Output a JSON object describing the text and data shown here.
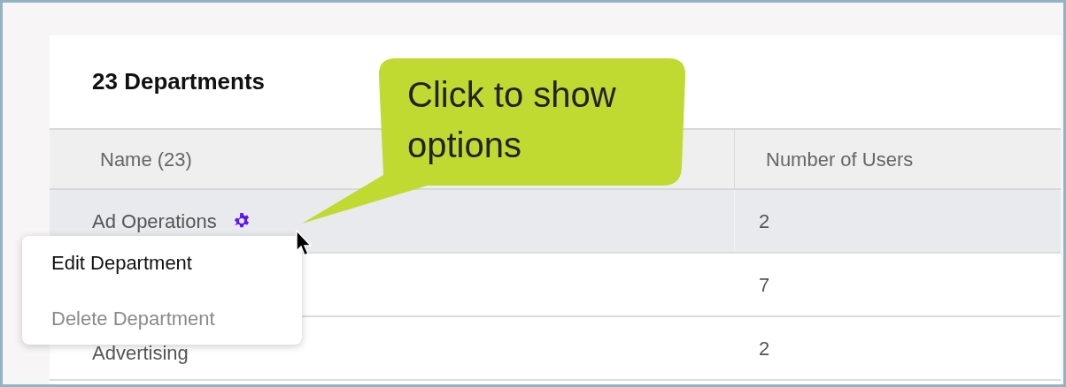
{
  "title": "23 Departments",
  "table": {
    "columns": [
      "Name (23)",
      "Number of Users"
    ],
    "rows": [
      {
        "name": "Ad Operations",
        "users": "2",
        "selected": true,
        "options_icon": true
      },
      {
        "users": "7",
        "selected": false,
        "options_icon": false
      },
      {
        "name": "Advertising",
        "users": "2",
        "selected": false,
        "options_icon": false
      }
    ]
  },
  "menu": {
    "items": [
      {
        "label": "Edit Department",
        "disabled": false
      },
      {
        "label": "Delete Department",
        "disabled": true
      }
    ]
  },
  "callout": {
    "text": "Click to show options"
  }
}
